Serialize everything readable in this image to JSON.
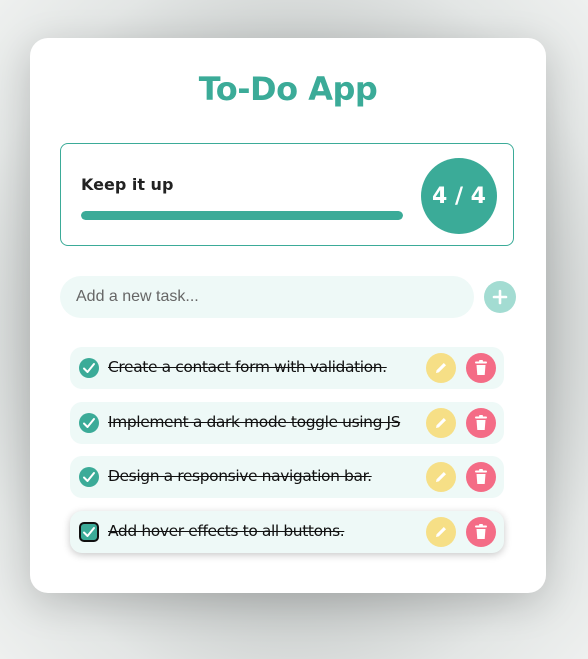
{
  "app": {
    "title": "To-Do App"
  },
  "progress": {
    "label": "Keep it up",
    "count_text": "4 / 4",
    "completed_fraction": 1.0
  },
  "new_task": {
    "placeholder": "Add a new task...",
    "value": ""
  },
  "tasks": [
    {
      "text": "Create a contact form with validation.",
      "completed": true
    },
    {
      "text": "Implement a dark mode toggle using JS",
      "completed": true
    },
    {
      "text": "Design a responsive navigation bar.",
      "completed": true
    },
    {
      "text": "Add hover effects to all buttons.",
      "completed": true
    }
  ],
  "icons": {
    "check": "check-icon",
    "add": "plus-icon",
    "edit": "pencil-icon",
    "delete": "trash-icon"
  },
  "colors": {
    "accent": "#3bab98",
    "edit": "#f6df86",
    "delete": "#f46c86",
    "task_bg": "#eef9f7"
  }
}
